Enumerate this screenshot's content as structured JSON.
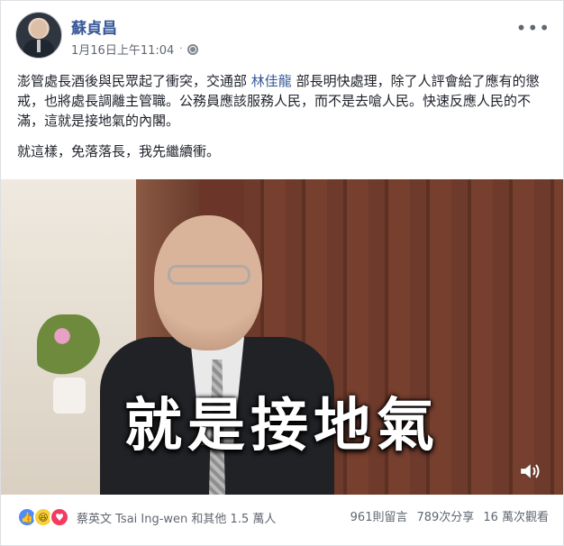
{
  "post": {
    "author": "蘇貞昌",
    "timestamp": "1月16日上午11:04",
    "separator": "·",
    "more_label": "•••"
  },
  "content": {
    "paragraph1_before": "澎管處長酒後與民眾起了衝突，交通部 ",
    "mention": "林佳龍",
    "paragraph1_after": " 部長明快處理，除了人評會給了應有的懲戒，也將處長調離主管職。公務員應該服務人民，而不是去嗆人民。快速反應人民的不滿，這就是接地氣的內閣。",
    "paragraph2": "就這樣，免落落長，我先繼續衝。"
  },
  "video": {
    "caption": "就是接地氣"
  },
  "footer": {
    "reactions_text": "蔡英文 Tsai Ing-wen 和其他 1.5 萬人",
    "comments": "961則留言",
    "shares": "789次分享",
    "views": "16 萬次觀看"
  },
  "icons": {
    "privacy": "globe-icon",
    "like": "like-icon",
    "haha": "haha-icon",
    "love": "love-icon",
    "sound": "volume-icon"
  },
  "colors": {
    "link": "#385898",
    "like": "#4f8cf6",
    "love": "#f23b5f",
    "haha": "#f7d13a"
  }
}
